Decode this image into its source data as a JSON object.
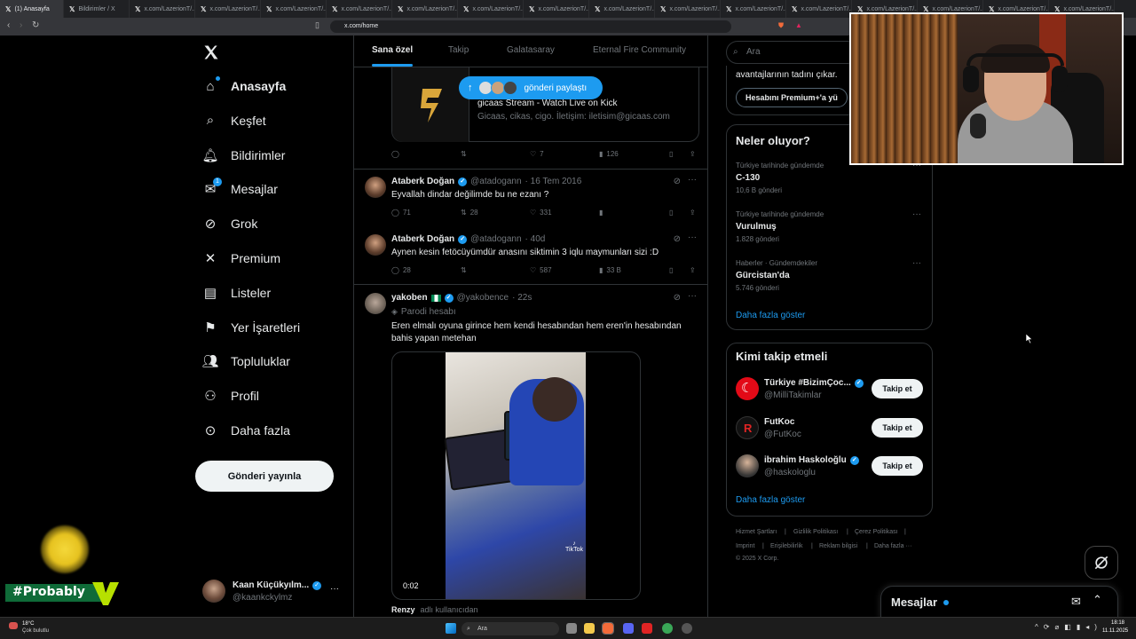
{
  "browser": {
    "tabs": [
      {
        "label": "(1) Anasayfa",
        "active": true
      },
      {
        "label": "Bildirimler / X"
      },
      {
        "label": "x.com/LazerionT/..."
      },
      {
        "label": "x.com/LazerionT/..."
      },
      {
        "label": "x.com/LazerionT/..."
      },
      {
        "label": "x.com/LazerionT/..."
      },
      {
        "label": "x.com/LazerionT/..."
      },
      {
        "label": "x.com/LazerionT/..."
      },
      {
        "label": "x.com/LazerionT/..."
      },
      {
        "label": "x.com/LazerionT/..."
      },
      {
        "label": "x.com/LazerionT/..."
      },
      {
        "label": "x.com/LazerionT/..."
      },
      {
        "label": "x.com/LazerionT/..."
      },
      {
        "label": "x.com/LazerionT/..."
      },
      {
        "label": "x.com/LazerionT/..."
      },
      {
        "label": "x.com/LazerionT/..."
      },
      {
        "label": "x.com/LazerionT/..."
      }
    ],
    "url": "x.com/home"
  },
  "nav": {
    "items": [
      {
        "label": "Anasayfa",
        "icon": "home-icon"
      },
      {
        "label": "Keşfet",
        "icon": "search-icon"
      },
      {
        "label": "Bildirimler",
        "icon": "bell-icon"
      },
      {
        "label": "Mesajlar",
        "icon": "mail-icon",
        "badge": "1"
      },
      {
        "label": "Grok",
        "icon": "grok-icon"
      },
      {
        "label": "Premium",
        "icon": "x-logo-icon"
      },
      {
        "label": "Listeler",
        "icon": "list-icon"
      },
      {
        "label": "Yer İşaretleri",
        "icon": "bookmark-icon"
      },
      {
        "label": "Topluluklar",
        "icon": "communities-icon"
      },
      {
        "label": "Profil",
        "icon": "person-icon"
      },
      {
        "label": "Daha fazla",
        "icon": "more-circle-icon"
      }
    ],
    "post_button": "Gönderi yayınla",
    "account": {
      "name": "Kaan Küçükyılm...",
      "handle": "@kaankckylmz"
    }
  },
  "overlay": {
    "hashtag": "#Probably"
  },
  "feed": {
    "tabs": [
      "Sana özel",
      "Takip",
      "Galatasaray",
      "Eternal Fire Community"
    ],
    "share_pill": "gönderi paylaştı",
    "card": {
      "title": "gicaas Stream - Watch Live on Kick",
      "desc": "Gicaas, cikas, cigo. İletişim: iletisim@gicaas.com"
    },
    "card_actions": {
      "likes": "7",
      "views": "126"
    },
    "posts": [
      {
        "name": "Ataberk Doğan",
        "handle": "@atadogann",
        "date": "· 16 Tem 2016",
        "text": "Eyvallah dindar değilimde bu ne ezanı ?",
        "replies": "71",
        "reposts": "28",
        "likes": "331",
        "views": ""
      },
      {
        "name": "Ataberk Doğan",
        "handle": "@atadogann",
        "date": "· 40d",
        "text": "Aynen kesin fetöcüyümdür anasını siktimin 3 iqlu maymunları sizi :D",
        "replies": "28",
        "reposts": "",
        "likes": "587",
        "views": "33 B"
      },
      {
        "name": "yakoben",
        "handle": "@yakobence",
        "date": "· 22s",
        "label": "Parodi hesabı",
        "text": "Eren elmalı oyuna girince hem kendi hesabından hem eren'in hesabından bahis yapan metehan",
        "video_time": "0:02"
      }
    ],
    "next_post": {
      "name": "Renzy",
      "sub": "adlı kullanıcıdan"
    }
  },
  "right": {
    "search_placeholder": "Ara",
    "premium_text": "avantajlarının tadını çıkar.",
    "premium_button": "Hesabını Premium+'a yü",
    "trends_title": "Neler oluyor?",
    "trends": [
      {
        "context": "Türkiye tarihinde gündemde",
        "topic": "C-130",
        "count": "10,6 B gönderi"
      },
      {
        "context": "Türkiye tarihinde gündemde",
        "topic": "Vurulmuş",
        "count": "1.828 gönderi"
      },
      {
        "context": "Haberler · Gündemdekiler",
        "topic": "Gürcistan'da",
        "count": "5.746 gönderi"
      }
    ],
    "show_more": "Daha fazla göster",
    "who_title": "Kimi takip etmeli",
    "who": [
      {
        "name": "Türkiye #BizimÇoc...",
        "handle": "@MilliTakimlar",
        "button": "Takip et"
      },
      {
        "name": "FutKoc",
        "handle": "@FutKoc",
        "button": "Takip et"
      },
      {
        "name": "ibrahim Haskoloğlu",
        "handle": "@haskologlu",
        "button": "Takip et"
      }
    ],
    "who_more": "Daha fazla göster",
    "footer": [
      "Hizmet Şartları",
      "|",
      "Gizlilik Politikası",
      "|",
      "Çerez Politikası",
      "|",
      "Imprint",
      "|",
      "Erişilebilirlik",
      "|",
      "Reklam bilgisi",
      "|",
      "Daha fazla ···",
      "© 2025 X Corp."
    ]
  },
  "messages": {
    "title": "Mesajlar"
  },
  "taskbar": {
    "weather_temp": "18°C",
    "weather_desc": "Çok bulutlu",
    "search": "Ara",
    "time": "18:18",
    "date": "11.11.2025"
  },
  "colors": {
    "accent": "#1d9bf0",
    "border": "#2f3336",
    "muted": "#71767b"
  }
}
